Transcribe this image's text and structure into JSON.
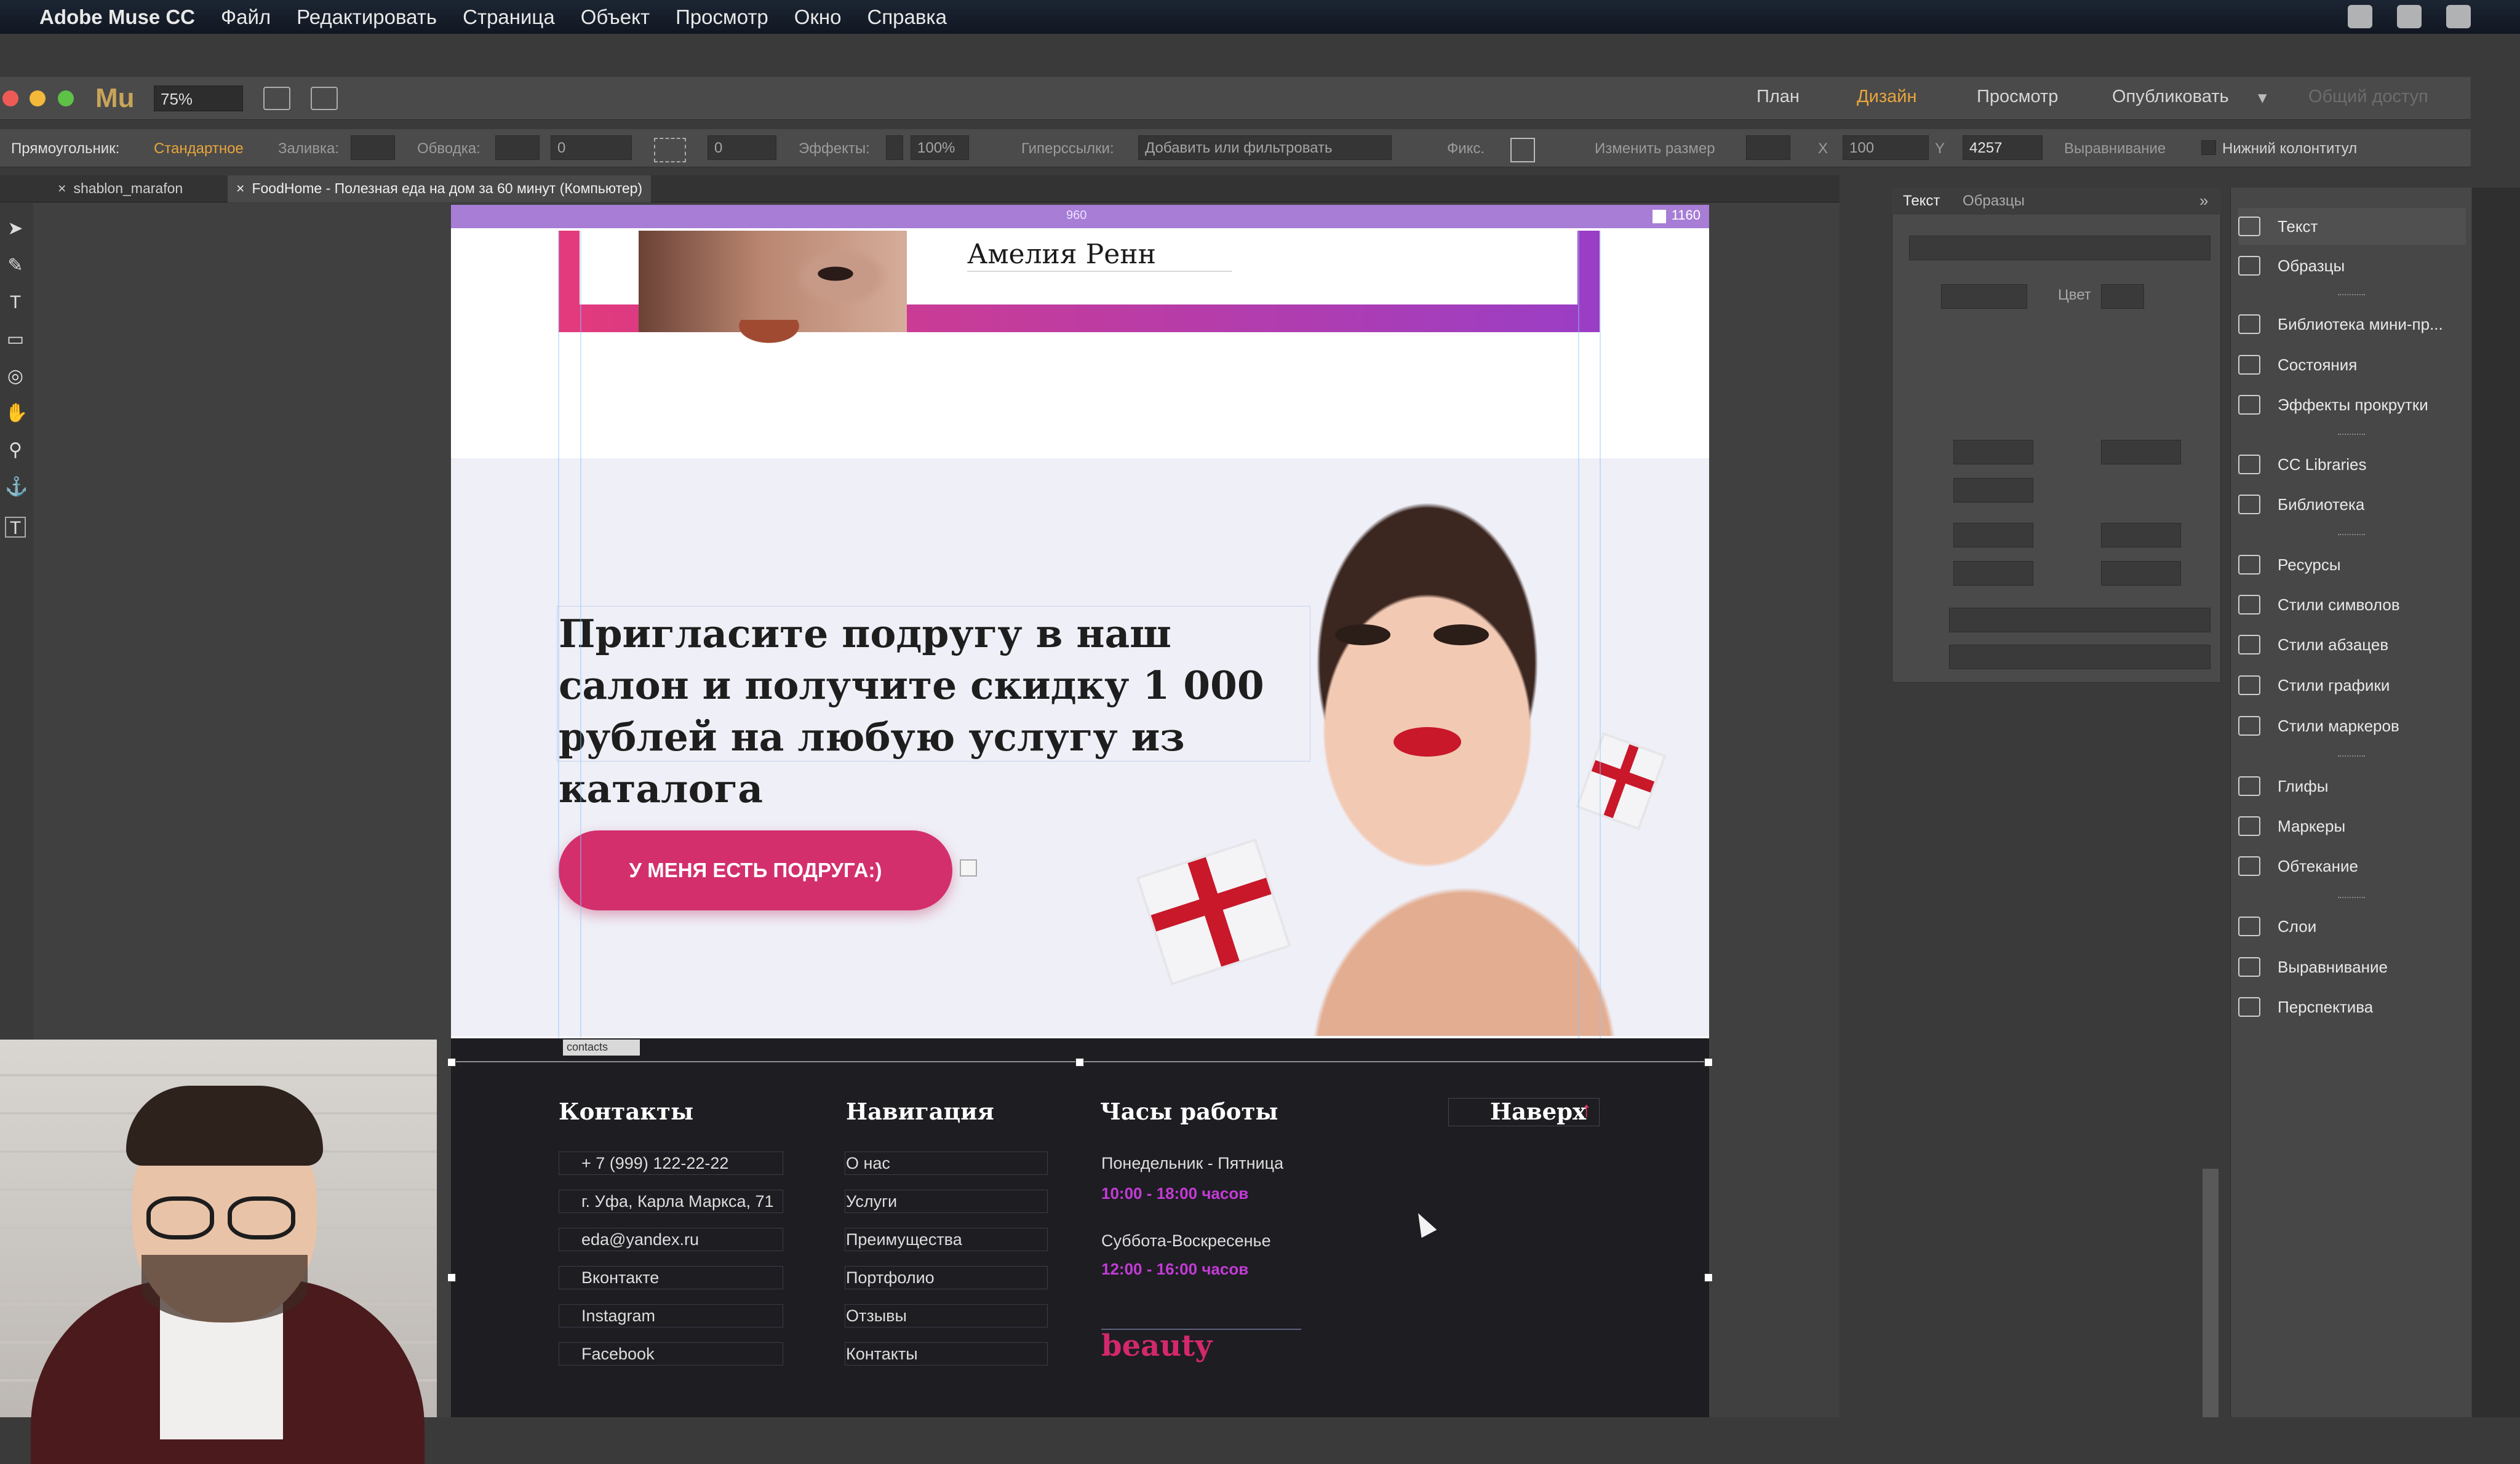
{
  "menubar": {
    "app_name": "Adobe Muse CC",
    "items": [
      "Файл",
      "Редактировать",
      "Страница",
      "Объект",
      "Просмотр",
      "Окно",
      "Справка"
    ]
  },
  "toolbar": {
    "logo": "Mu",
    "zoom": "75%",
    "nav": {
      "plan": "План",
      "design": "Дизайн",
      "preview": "Просмотр",
      "publish": "Опубликовать",
      "shared": "Общий доступ"
    }
  },
  "controlbar": {
    "shape_label": "Прямоугольник:",
    "shape_value": "Стандартное",
    "fill_label": "Заливка:",
    "stroke_label": "Обводка:",
    "stroke_value": "0",
    "corner_value": "0",
    "effects_label": "Эффекты:",
    "opacity": "100%",
    "hyperlinks_label": "Гиперссылки:",
    "hyperlinks_value": "Добавить или фильтровать",
    "fix_label": "Фикс.",
    "resize_label": "Изменить размер",
    "x_label": "X",
    "x_value": "100",
    "y_label": "Y",
    "y_value": "4257",
    "align_label": "Выравнивание",
    "footer_label": "Нижний колонтитул"
  },
  "tabs": [
    {
      "label": "shablon_marafon"
    },
    {
      "label": "FoodHome - Полезная еда на дом за 60 минут (Компьютер)"
    }
  ],
  "ruler": {
    "center": "960",
    "right": "1160"
  },
  "site": {
    "testimonial_name": "Амелия Ренн",
    "promo_text": "Пригласите подругу в наш салон и получите скидку 1 000 рублей на любую услугу из каталога",
    "cta_label": "У МЕНЯ ЕСТЬ ПОДРУГА:)",
    "anchor_label": "contacts",
    "footer": {
      "contacts": {
        "title": "Контакты",
        "items": [
          "+ 7 (999) 122-22-22",
          "г. Уфа, Карла Маркса, 71",
          "eda@yandex.ru",
          "Вконтакте",
          "Instagram",
          "Facebook"
        ]
      },
      "navigation": {
        "title": "Навигация",
        "items": [
          "О нас",
          "Услуги",
          "Преимущества",
          "Портфолио",
          "Отзывы",
          "Контакты"
        ]
      },
      "hours": {
        "title": "Часы работы",
        "weekdays": "Понедельник - Пятница",
        "weekdays_time": "10:00 - 18:00 часов",
        "weekend": "Суббота-Воскресенье",
        "weekend_time": "12:00 - 16:00 часов"
      },
      "to_top": "Наверх",
      "logo": "beauty"
    }
  },
  "text_panel": {
    "tab_text": "Текст",
    "tab_samples": "Образцы",
    "color_label": "Цвет"
  },
  "dock": {
    "items": [
      "Текст",
      "Образцы",
      "Библиотека мини-пр...",
      "Состояния",
      "Эффекты прокрутки",
      "CC Libraries",
      "Библиотека",
      "Ресурсы",
      "Стили символов",
      "Стили абзацев",
      "Стили графики",
      "Стили маркеров",
      "Глифы",
      "Маркеры",
      "Обтекание",
      "Слои",
      "Выравнивание",
      "Перспектива"
    ]
  },
  "colors": {
    "accent_pink": "#d32f6c",
    "hour_purple": "#c43bd6",
    "design_orange": "#e8a53b"
  }
}
